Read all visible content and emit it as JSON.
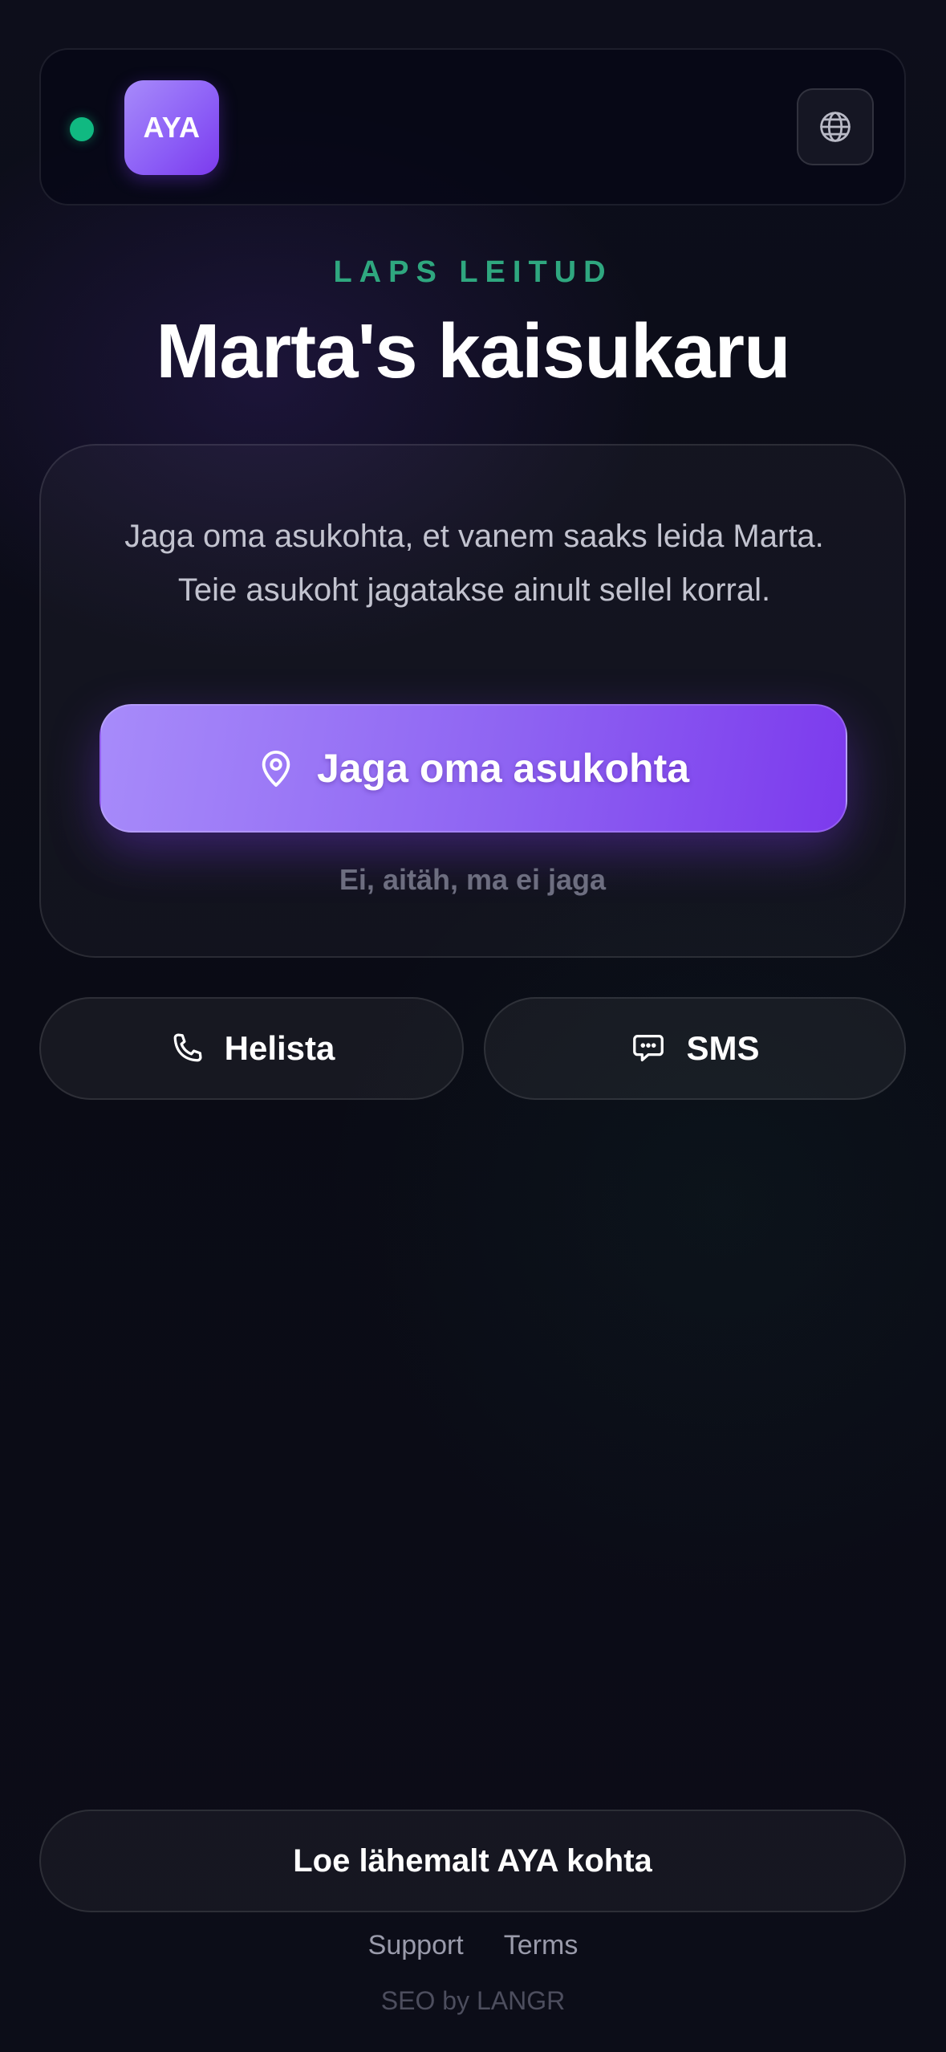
{
  "header": {
    "logo_text": "AYA",
    "status_color": "#10b981",
    "language_icon": "globe-icon"
  },
  "hero": {
    "eyebrow": "LAPS LEITUD",
    "title": "Marta's kaisukaru"
  },
  "card": {
    "description": "Jaga oma asukohta, et vanem saaks leida Marta. Teie asukoht jagatakse ainult sellel korral.",
    "share_button_label": "Jaga oma asukohta",
    "share_icon": "location-pin-icon",
    "decline_label": "Ei, aitäh, ma ei jaga"
  },
  "contact": {
    "call_label": "Helista",
    "call_icon": "phone-icon",
    "sms_label": "SMS",
    "sms_icon": "chat-bubble-icon"
  },
  "footer": {
    "learn_more_label": "Loe lähemalt AYA kohta",
    "links": [
      "Support",
      "Terms"
    ],
    "credit": "SEO by LANGR"
  },
  "colors": {
    "accent": "#8b5cf6",
    "accent_dark": "#7c3aed",
    "eyebrow": "#2fa77f",
    "background": "#0b0c16"
  }
}
